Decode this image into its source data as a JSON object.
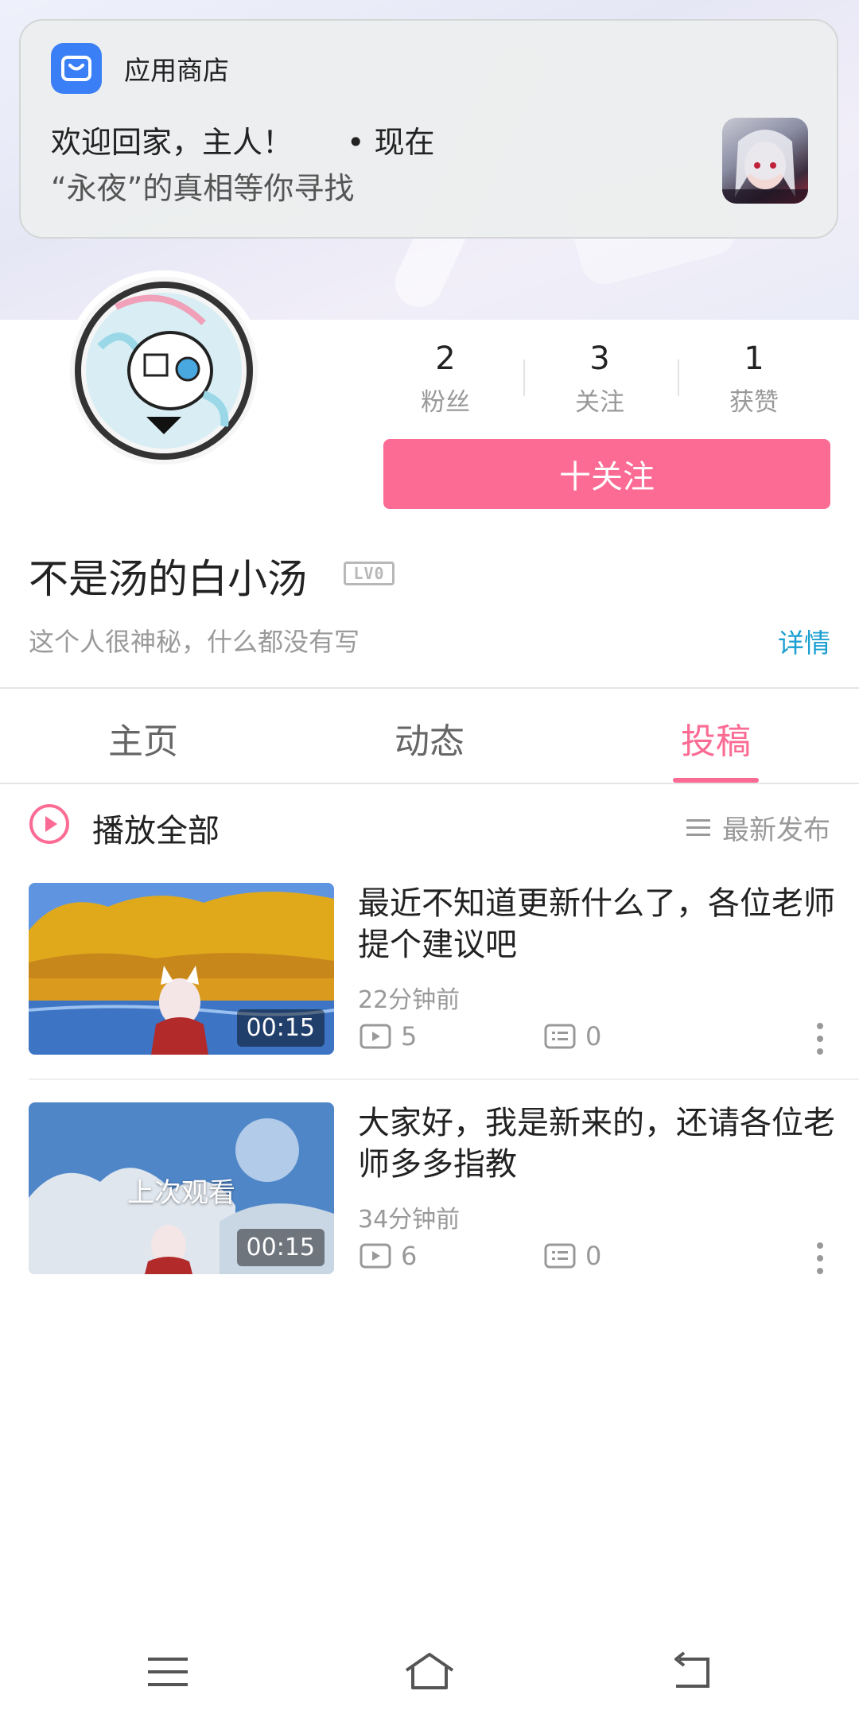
{
  "notification": {
    "app_name": "应用商店",
    "title": "欢迎回家，主人！",
    "time": "• 现在",
    "body": "“永夜”的真相等你寻找"
  },
  "profile": {
    "stats": [
      {
        "num": "2",
        "label": "粉丝"
      },
      {
        "num": "3",
        "label": "关注"
      },
      {
        "num": "1",
        "label": "获赞"
      }
    ],
    "follow_label": "十关注",
    "username": "不是汤的白小汤",
    "level": "LV0",
    "bio": "这个人很神秘，什么都没有写",
    "detail_label": "详情"
  },
  "tabs": [
    "主页",
    "动态",
    "投稿"
  ],
  "active_tab": "投稿",
  "list_header": {
    "play_all": "播放全部",
    "sort": "最新发布"
  },
  "videos": [
    {
      "title": "最近不知道更新什么了，各位老师提个建议吧",
      "time": "22分钟前",
      "plays": "5",
      "comments": "0",
      "duration": "00:15",
      "overlay": ""
    },
    {
      "title": "大家好，我是新来的，还请各位老师多多指教",
      "time": "34分钟前",
      "plays": "6",
      "comments": "0",
      "duration": "00:15",
      "overlay": "上次观看"
    }
  ],
  "colors": {
    "accent": "#fb6b93",
    "link": "#1a9fd1",
    "store_icon": "#3b7ff6"
  },
  "icons": [
    "play-circle-icon",
    "list-icon",
    "play-count-icon",
    "comment-icon",
    "more-icon",
    "menu-icon",
    "home-icon",
    "back-icon"
  ]
}
